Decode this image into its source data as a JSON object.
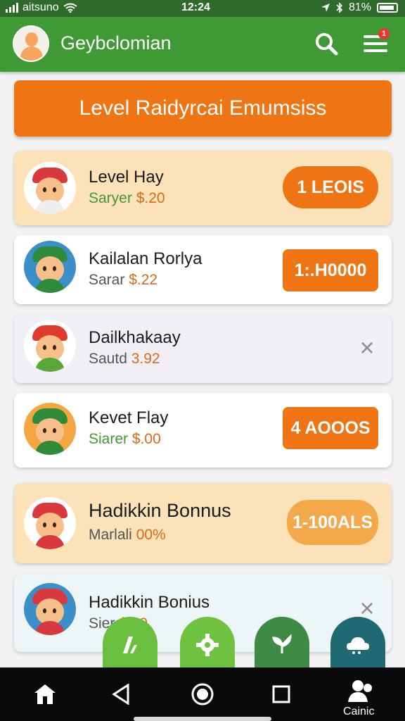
{
  "status_bar": {
    "carrier": "aitsuno",
    "time": "12:24",
    "battery": "81%"
  },
  "header": {
    "title": "Geybclomian",
    "notification_count": "1"
  },
  "banner": {
    "text": "Level Raidyrcai Emumsiss"
  },
  "items": [
    {
      "name": "Level Hay",
      "sub_label": "Saryer",
      "sub_value": "$.20",
      "sub_color": "#3f9a2f",
      "action": "1 LEOIS",
      "bg": "peach",
      "action_type": "pill"
    },
    {
      "name": "Kailalan Rorlya",
      "sub_label": "Sarar",
      "sub_value": "$.22",
      "sub_color": "#555555",
      "action": "1:.H0000",
      "bg": "white",
      "action_type": "square"
    },
    {
      "name": "Dailkhakaay",
      "sub_label": "Sautd",
      "sub_value": "3.92",
      "sub_color": "#555555",
      "action": "×",
      "bg": "lav",
      "action_type": "close"
    },
    {
      "name": "Kevet Flay",
      "sub_label": "Siarer",
      "sub_value": "$.00",
      "sub_color": "#3f9a2f",
      "action": "4 AOOOS",
      "bg": "white",
      "action_type": "square"
    },
    {
      "name": "Hadikkin Bonnus",
      "sub_label": "Marlali",
      "sub_value": "00%",
      "sub_color": "#555555",
      "action": "1-100ALS",
      "bg": "peach",
      "action_type": "pill-light"
    },
    {
      "name": "Hadikkin Bonius",
      "sub_label": "Sier",
      "sub_value": "$.00",
      "sub_color": "#555555",
      "action": "×",
      "bg": "mint",
      "action_type": "close"
    }
  ],
  "bottom_nav": {
    "label": "Cainic"
  },
  "colors": {
    "primary": "#3f9a35",
    "accent": "#ee7414",
    "status": "#2e6b2b"
  }
}
